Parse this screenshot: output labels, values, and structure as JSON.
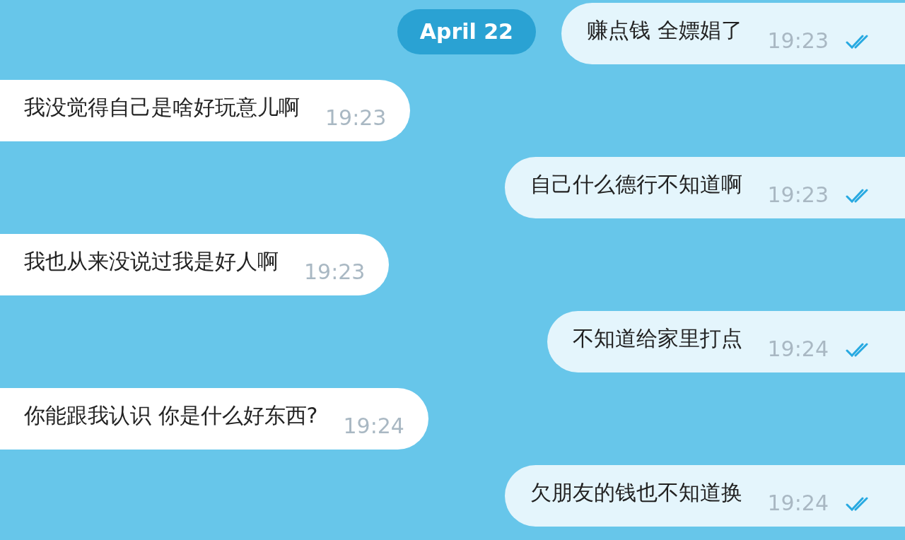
{
  "date_badge": {
    "label": "April 22"
  },
  "messages": [
    {
      "kind": "outgoing",
      "text": "赚点钱 全嫖娼了",
      "time": "19:23",
      "read": true
    },
    {
      "kind": "incoming",
      "text": "我没觉得自己是啥好玩意儿啊",
      "time": "19:23"
    },
    {
      "kind": "outgoing",
      "text": "自己什么德行不知道啊",
      "time": "19:23",
      "read": true
    },
    {
      "kind": "incoming",
      "text": "我也从来没说过我是好人啊",
      "time": "19:23"
    },
    {
      "kind": "outgoing",
      "text": "不知道给家里打点",
      "time": "19:24",
      "read": true
    },
    {
      "kind": "incoming",
      "text": "你能跟我认识 你是什么好东西?",
      "time": "19:24"
    },
    {
      "kind": "outgoing",
      "text": "欠朋友的钱也不知道换",
      "time": "19:24",
      "read": true
    }
  ]
}
